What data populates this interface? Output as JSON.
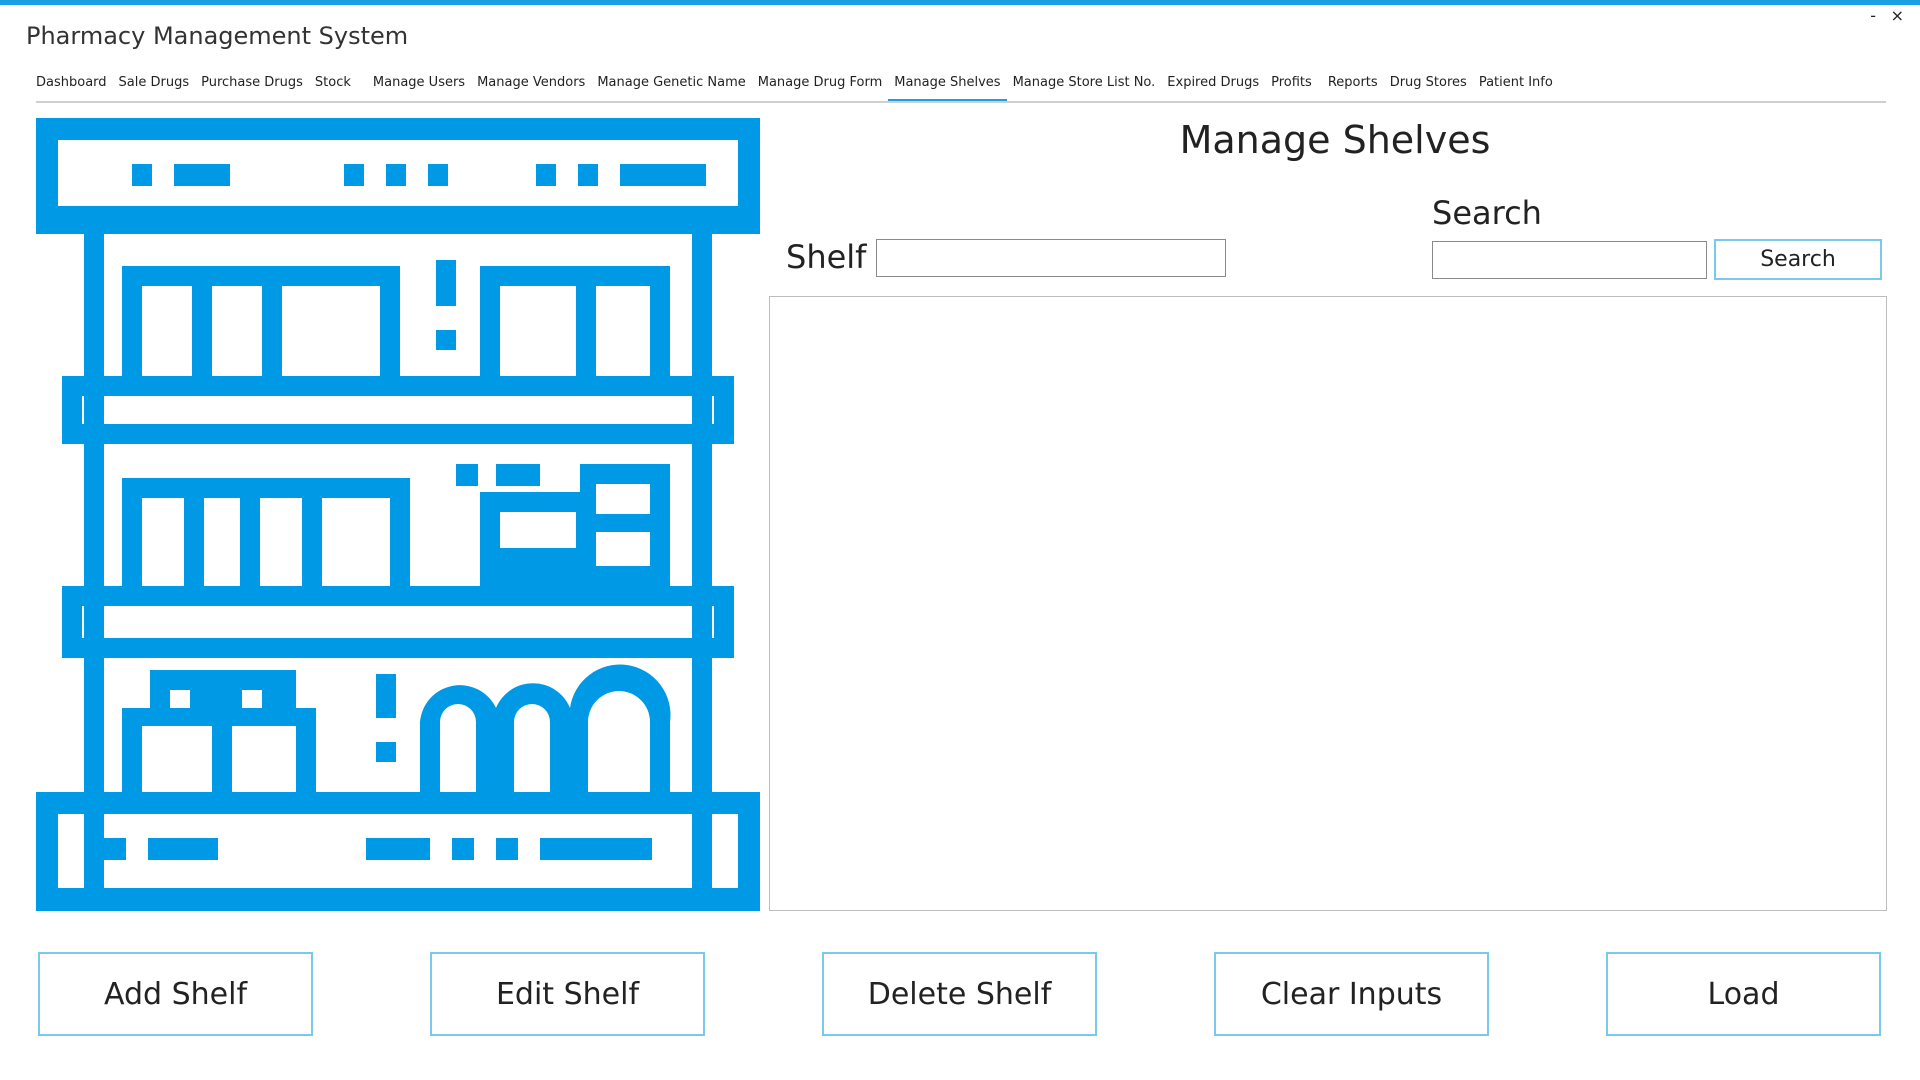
{
  "window": {
    "title": "Pharmacy Management System",
    "minimize_glyph": "-",
    "close_glyph": "×"
  },
  "nav": {
    "tabs": [
      {
        "label": "Dashboard"
      },
      {
        "label": "Sale Drugs"
      },
      {
        "label": "Purchase Drugs"
      },
      {
        "label": "Stock"
      },
      {
        "label": "Manage Users"
      },
      {
        "label": "Manage Vendors"
      },
      {
        "label": "Manage Genetic Name"
      },
      {
        "label": "Manage Drug Form"
      },
      {
        "label": "Manage Shelves"
      },
      {
        "label": "Manage Store List No."
      },
      {
        "label": "Expired Drugs"
      },
      {
        "label": "Profits"
      },
      {
        "label": "Reports"
      },
      {
        "label": "Drug Stores"
      },
      {
        "label": "Patient Info"
      }
    ],
    "active_tab": "Manage Shelves"
  },
  "page": {
    "heading": "Manage Shelves",
    "shelf_label": "Shelf",
    "shelf_value": "",
    "search_label": "Search",
    "search_value": "",
    "search_button": "Search"
  },
  "illustration": {
    "icon": "pharmacy-shelves-icon",
    "color": "#0099e5"
  },
  "actions": {
    "add": "Add Shelf",
    "edit": "Edit Shelf",
    "delete": "Delete Shelf",
    "clear": "Clear Inputs",
    "load": "Load"
  },
  "colors": {
    "accent": "#1ba1e2",
    "button_border": "#79c9ee"
  }
}
